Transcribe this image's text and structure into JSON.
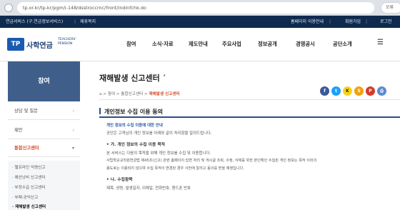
{
  "browser": {
    "url": "tp.or.kr/tp-kr/pgm/i-148/dsstroccrnc/front/indinfchk.do",
    "profile": "오류"
  },
  "utility": {
    "left1": "연금서비스 (구.연금정보서비스)",
    "left2": "제휴복지",
    "right1": "홈페이지 이용안내",
    "right2": "회원가입",
    "right3": "로그인"
  },
  "header": {
    "logo_mark": "TP",
    "logo_text": "사학연금",
    "logo_en_1": "TEACHERS'",
    "logo_en_2": "PENSION",
    "gnb": [
      "참여",
      "소식·자료",
      "제도안내",
      "주요사업",
      "정보공개",
      "경영공시",
      "공단소개"
    ]
  },
  "sidebar": {
    "title": "참여",
    "items": [
      {
        "label": "상담 및 질문"
      },
      {
        "label": "제안"
      },
      {
        "label": "통합신고센터"
      }
    ],
    "sub_items": [
      "· 헬프라인 익명신고",
      "· 예산낭비 신고센터",
      "· 부정수급 신고센터",
      "· 부패·공익신고",
      "· 재해발생 신고센터"
    ]
  },
  "main": {
    "page_title": "재해발생 신고센터",
    "page_title_mark": "´",
    "breadcrumb": {
      "home": "⌂",
      "sep": ">",
      "level1": "참여",
      "level2": "통합신고센터",
      "current": "재해발생 신고센터"
    },
    "sns": [
      {
        "icon": "facebook-icon",
        "text": "f",
        "color": "#3b5998"
      },
      {
        "icon": "twitter-icon",
        "text": "t",
        "color": "#1da1f2"
      },
      {
        "icon": "kakaotalk-icon",
        "text": "K",
        "color": "#f7d417"
      },
      {
        "icon": "kakaostory-icon",
        "text": "S",
        "color": "#f1a10f"
      },
      {
        "icon": "pdf-icon",
        "text": "P",
        "color": "#d43b2a"
      },
      {
        "icon": "print-icon",
        "text": "⎙",
        "color": "#5b8bd0"
      }
    ],
    "section_title": "개인정보 수집 이용 동의",
    "agree": {
      "heading": "개인 정보의 수집 이용에 대한 안내",
      "intro": "공단은 고객님의 개인 정보를 아래와 같이 처리함을 알려드립니다.",
      "purpose_title": "• 가. 개인 정보의 수집 이용 목적",
      "purpose_1": "본 서비스는 다음의 목적을 위해 개인 정보를 수집 및 이용합니다.",
      "purpose_2": "사립학교교직원연금법 제45조(신고) 관련 홈페이지 답변 처리 및 게시글 조회, 수정, 삭제를 위한 본인확인 수집된 개인 정보는 목적 이외의",
      "purpose_3": "용도로는 이용되지 않으며 수집 목적이 변경된 경우 사전에 알리고 동의를 받을 예정입니다.",
      "items_title": "• 나. 수집항목",
      "items_1": "제목, 성명, 발생일자, 이메일, 전화번호, 핸드폰 번호"
    }
  }
}
